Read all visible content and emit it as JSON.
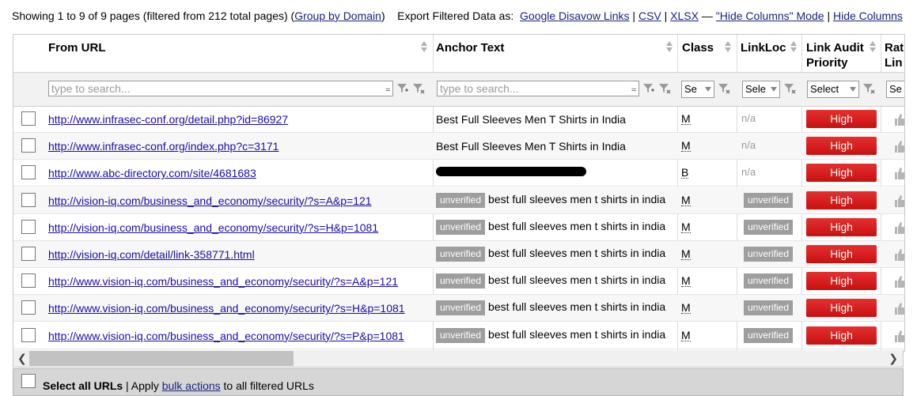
{
  "top": {
    "showing": "Showing 1 to 9 of 9 pages (filtered from 212 total pages) (",
    "group_link": "Group by Domain",
    "close_paren": ")",
    "export_label": "Export Filtered Data as:",
    "google_link": "Google Disavow Links",
    "sep": "|",
    "csv_link": "CSV",
    "xlsx_link": "XLSX",
    "dash": "—",
    "hide_mode_link": "\"Hide Columns\" Mode",
    "hide_columns_link": "Hide Columns"
  },
  "headers": {
    "from_url": "From URL",
    "anchor_text": "Anchor Text",
    "class": "Class",
    "linkloc": "LinkLoc",
    "priority": "Link Audit Priority",
    "rating": "Rat Lin"
  },
  "filters": {
    "search_placeholder": "type to search...",
    "approx": "≈",
    "class_select": "Se",
    "linkloc_select": "Sele",
    "priority_select": "Select",
    "rating_select": "Se"
  },
  "rows": [
    {
      "url": "http://www.infrasec-conf.org/detail.php?id=86927",
      "verified": true,
      "anchor": "Best Full Sleeves Men T Shirts in India",
      "class": "M",
      "linkloc": "n/a",
      "priority": "High"
    },
    {
      "url": "http://www.infrasec-conf.org/index.php?c=3171",
      "verified": true,
      "anchor": "Best Full Sleeves Men T Shirts in India",
      "class": "M",
      "linkloc": "n/a",
      "priority": "High"
    },
    {
      "url": "http://www.abc-directory.com/site/4681683",
      "verified": true,
      "anchor": "",
      "redacted": true,
      "class": "B",
      "linkloc": "n/a",
      "priority": "High"
    },
    {
      "url": "http://vision-iq.com/business_and_economy/security/?s=A&p=121",
      "verified": false,
      "badge": "unverified",
      "anchor": "best full sleeves men t shirts in india",
      "class": "M",
      "linkloc": "unverified",
      "priority": "High"
    },
    {
      "url": "http://vision-iq.com/business_and_economy/security/?s=H&p=1081",
      "verified": false,
      "badge": "unverified",
      "anchor": "best full sleeves men t shirts in india",
      "class": "M",
      "linkloc": "unverified",
      "priority": "High"
    },
    {
      "url": "http://vision-iq.com/detail/link-358771.html",
      "verified": false,
      "badge": "unverified",
      "anchor": "best full sleeves men t shirts in india",
      "class": "M",
      "linkloc": "unverified",
      "priority": "High"
    },
    {
      "url": "http://www.vision-iq.com/business_and_economy/security/?s=A&p=121",
      "verified": false,
      "badge": "unverified",
      "anchor": "best full sleeves men t shirts in india",
      "class": "M",
      "linkloc": "unverified",
      "priority": "High"
    },
    {
      "url": "http://www.vision-iq.com/business_and_economy/security/?s=H&p=1081",
      "verified": false,
      "badge": "unverified",
      "anchor": "best full sleeves men t shirts in india",
      "class": "M",
      "linkloc": "unverified",
      "priority": "High"
    },
    {
      "url": "http://www.vision-iq.com/business_and_economy/security/?s=P&p=1081",
      "verified": false,
      "badge": "unverified",
      "anchor": "best full sleeves men t shirts in india",
      "class": "M",
      "linkloc": "unverified",
      "priority": "High"
    }
  ],
  "footer": {
    "select_all": "Select all URLs",
    "sep": "| Apply",
    "bulk_link": "bulk actions",
    "rest": "to all filtered URLs"
  },
  "colors": {
    "priority_high": "#d81b1b",
    "badge": "#9e9e9e",
    "link": "#1a0dab"
  }
}
